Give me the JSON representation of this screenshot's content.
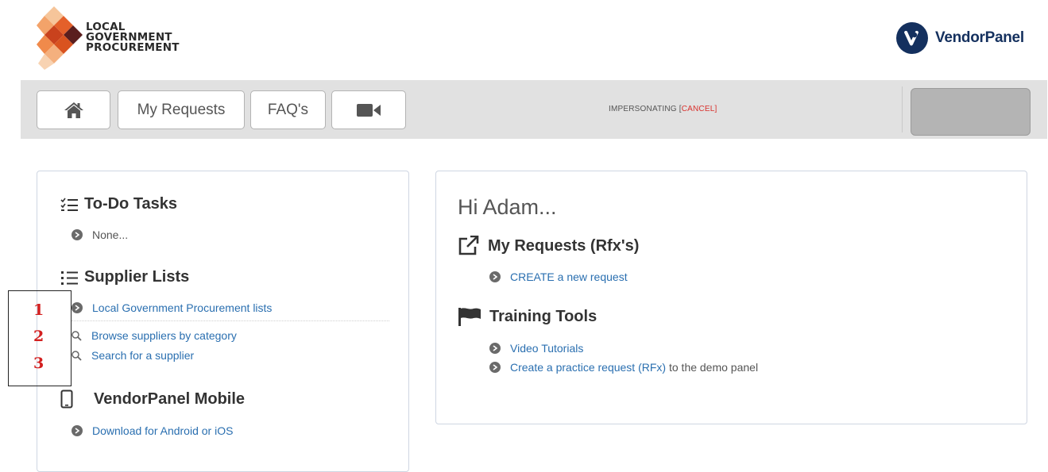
{
  "header": {
    "org_logo_lines": [
      "LOCAL",
      "GOVERNMENT",
      "PROCUREMENT"
    ],
    "brand_name": "VendorPanel",
    "brand_color": "#14305e"
  },
  "nav": {
    "home_icon": "home-icon",
    "my_requests_label": "My Requests",
    "faqs_label": "FAQ's",
    "video_icon": "video-camera-icon",
    "impersonating_label": "IMPERSONATING [",
    "cancel_label": "CANCEL",
    "impersonating_suffix": "]"
  },
  "left_panel": {
    "todo": {
      "title": "To-Do Tasks",
      "items": [
        "None..."
      ]
    },
    "supplier_lists": {
      "title": "Supplier Lists",
      "items": [
        "Local Government Procurement lists",
        "Browse suppliers by category",
        "Search for a supplier"
      ]
    },
    "mobile": {
      "title": "VendorPanel Mobile",
      "items": [
        "Download for Android or iOS"
      ]
    }
  },
  "right_panel": {
    "greeting": "Hi Adam...",
    "requests": {
      "title": "My Requests (Rfx's)",
      "items": [
        "CREATE a new request"
      ]
    },
    "training": {
      "title": "Training Tools",
      "video_tutorials": "Video Tutorials",
      "practice_prefix": "Create a practice request",
      "practice_link": "(RFx)",
      "practice_suffix": " to the demo panel"
    }
  },
  "annotations": [
    "1",
    "2",
    "3"
  ],
  "colors": {
    "link": "#2a6fb0",
    "cancel": "#d9302c",
    "annotation": "#d32020",
    "navbar": "#e1e1e1"
  }
}
